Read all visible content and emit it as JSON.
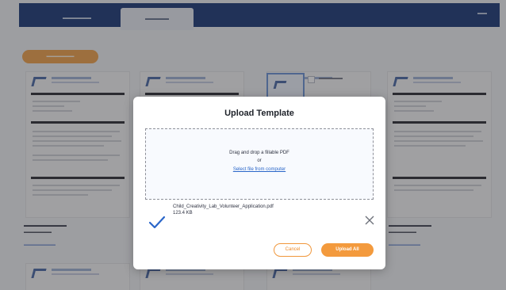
{
  "modal": {
    "title": "Upload Template",
    "dropzone": {
      "instruction": "Drag and drop a fillable PDF",
      "or": "or",
      "select_link": "Select file from computer"
    },
    "file": {
      "name": "Child_Creativity_Lab_Volunteer_Application.pdf",
      "size": "123.4 KB"
    },
    "cancel_label": "Cancel",
    "upload_label": "Upload All"
  },
  "colors": {
    "brand_navy": "#1c3a78",
    "accent_orange": "#f39a3d",
    "link_blue": "#2a66c9",
    "check_blue": "#2a66c9"
  },
  "icons": {
    "file_status": "checkmark-icon",
    "remove_file": "close-icon"
  }
}
